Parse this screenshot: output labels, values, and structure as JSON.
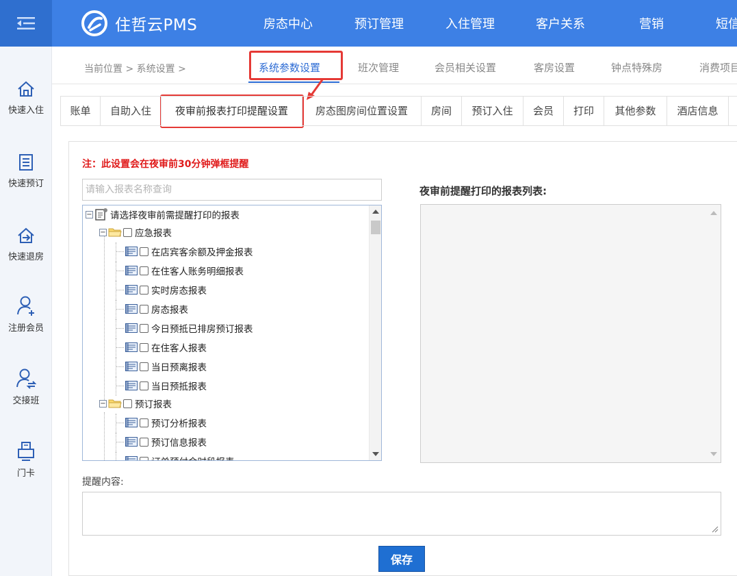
{
  "app": {
    "name": "住哲云PMS"
  },
  "nav": [
    "房态中心",
    "预订管理",
    "入住管理",
    "客户关系",
    "营销",
    "短信"
  ],
  "sidebar": [
    {
      "label": "快速入住",
      "icon": "home-icon"
    },
    {
      "label": "快速预订",
      "icon": "list-icon"
    },
    {
      "label": "快速退房",
      "icon": "checkout-icon"
    },
    {
      "label": "注册会员",
      "icon": "add-user-icon"
    },
    {
      "label": "交接班",
      "icon": "shift-exchange-icon"
    },
    {
      "label": "门卡",
      "icon": "printer-icon"
    }
  ],
  "breadcrumb": {
    "text": "当前位置 > 系统设置 >"
  },
  "top_tabs": [
    "系统参数设置",
    "班次管理",
    "会员相关设置",
    "客房设置",
    "钟点特殊房",
    "消费项目"
  ],
  "sub_tabs": [
    "账单",
    "自助入住",
    "夜审前报表打印提醒设置",
    "房态图房间位置设置",
    "房间",
    "预订入住",
    "会员",
    "打印",
    "其他参数",
    "酒店信息"
  ],
  "note": "注：此设置会在夜审前30分钟弹框提醒",
  "search": {
    "placeholder": "请输入报表名称查询"
  },
  "tree": {
    "root": "请选择夜审前需提醒打印的报表",
    "groups": [
      {
        "label": "应急报表",
        "items": [
          "在店宾客余额及押金报表",
          "在住客人账务明细报表",
          "实时房态报表",
          "房态报表",
          "今日预抵已排房预订报表",
          "在住客人报表",
          "当日预离报表",
          "当日预抵报表"
        ]
      },
      {
        "label": "预订报表",
        "items": [
          "预订分析报表",
          "预订信息报表",
          "订单预付金时段报表"
        ]
      }
    ]
  },
  "list_title": "夜审前提醒打印的报表列表:",
  "remind": {
    "label": "提醒内容:",
    "value": ""
  },
  "save_label": "保存",
  "colors": {
    "brand": "#3d80e5",
    "highlight": "#e53935",
    "note": "#e01b1b",
    "button": "#1f6fd2"
  }
}
